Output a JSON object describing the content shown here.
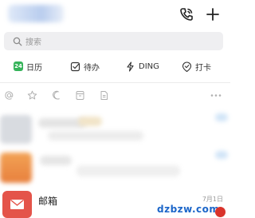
{
  "search": {
    "placeholder": "搜索"
  },
  "quick_actions": [
    {
      "label": "日历",
      "icon": "calendar-icon",
      "badge": "24"
    },
    {
      "label": "待办",
      "icon": "todo-check-icon"
    },
    {
      "label": "DING",
      "icon": "lightning-icon"
    },
    {
      "label": "打卡",
      "icon": "checkin-icon"
    }
  ],
  "filters": [
    "at-mention-icon",
    "star-icon",
    "moon-icon",
    "archive-icon",
    "document-icon",
    "more-icon"
  ],
  "mail": {
    "name": "邮箱",
    "date": "7月1日"
  },
  "watermark": {
    "text": "dzbzw.com"
  },
  "colors": {
    "accent": "#1c66c9",
    "mail_avatar": "#e4544a",
    "calendar_badge": "#36b35a"
  }
}
